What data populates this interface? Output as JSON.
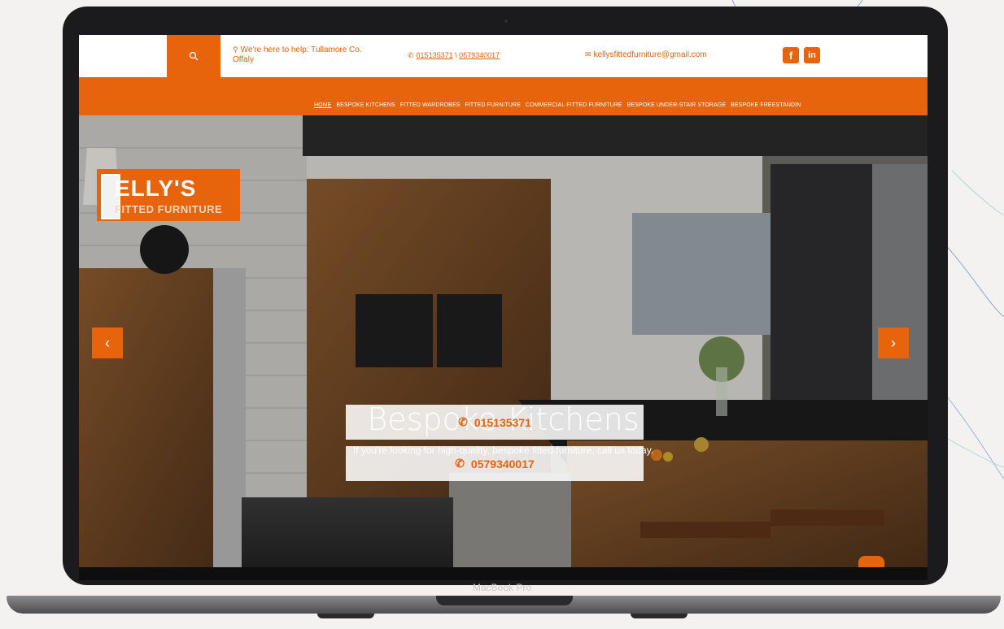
{
  "device": {
    "label": "MacBook Pro"
  },
  "topbar": {
    "search_icon": "search-icon",
    "help_text": "We're here to help: Tullamore Co. Offaly",
    "phone1": "015135371",
    "phone_sep": " \\ ",
    "phone2": "0579340017",
    "email": "kellysfittedfurniture@gmail.com",
    "facebook": "f",
    "linkedin": "in"
  },
  "nav": {
    "items": [
      "HOME",
      "BESPOKE KITCHENS",
      "FITTED WARDROBES",
      "FITTED FURNITURE",
      "COMMERCIAL FITTED FURNITURE",
      "BESPOKE UNDER-STAIR STORAGE",
      "BESPOKE FREESTANDIN"
    ]
  },
  "logo": {
    "line1": "ELLY'S",
    "line2": "FITTED FURNITURE"
  },
  "hero": {
    "title": "Bespoke Kitchens",
    "subtitle": "If you're looking for high-quality, bespoke fitted furniture, call us today.",
    "cta1": "015135371",
    "cta2": "0579340017",
    "prev": "‹",
    "next": "›"
  },
  "colors": {
    "accent": "#e8640c"
  }
}
